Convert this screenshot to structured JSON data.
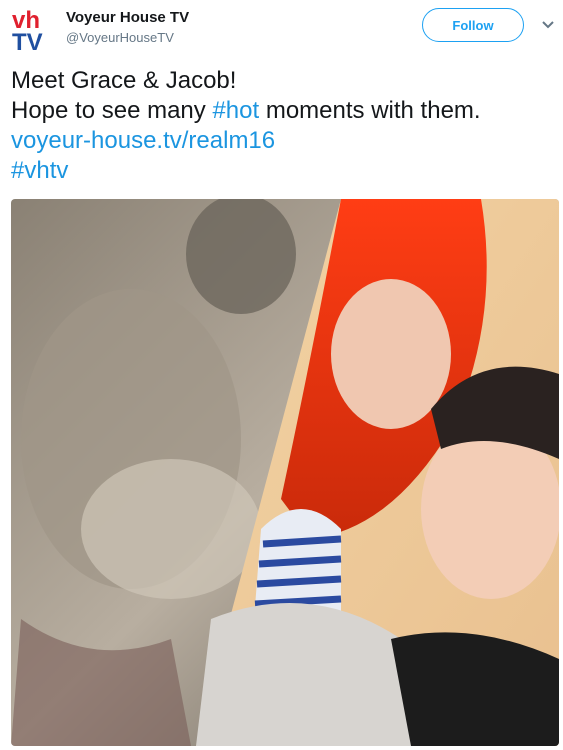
{
  "header": {
    "avatar_text": "vhTV",
    "display_name": "Voyeur House TV",
    "handle": "@VoyeurHouseTV",
    "follow_label": "Follow"
  },
  "tweet": {
    "line1": "Meet Grace & Jacob!",
    "line2_prefix": "Hope to see many ",
    "line2_hashtag": "#hot",
    "line2_suffix": " moments with them.",
    "link": "voyeur-house.tv/realm16",
    "hashtag": "#vhtv"
  },
  "colors": {
    "accent": "#1da1f2",
    "link": "#1b95e0",
    "brand_red": "#e0202e",
    "brand_blue": "#1f4fa0"
  },
  "icons": {
    "caret": "chevron-down-icon"
  }
}
